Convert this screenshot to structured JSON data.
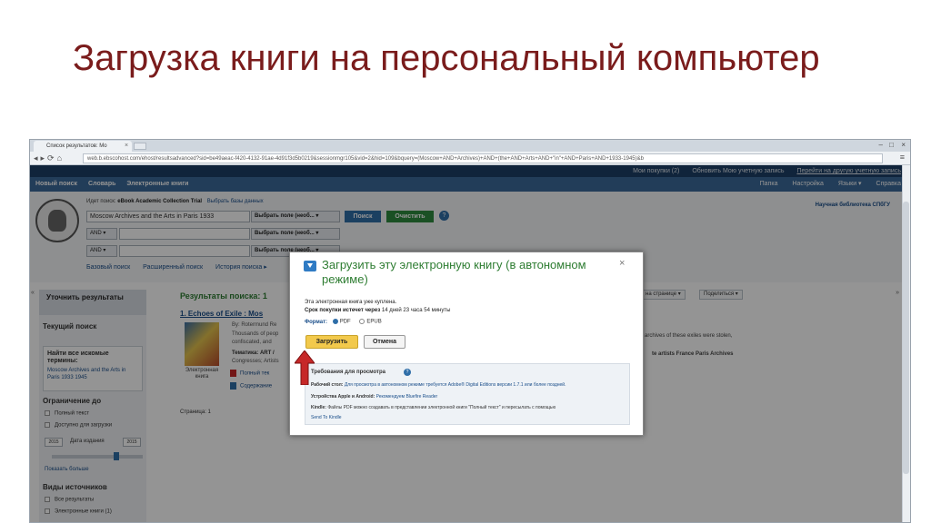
{
  "slide": {
    "title": "Загрузка книги на персональный компьютер"
  },
  "browser": {
    "tab_title": "Список результатов: Mo",
    "url": "web.b.ebscohost.com/ehost/resultsadvanced?sid=be49aeac-f420-4132-91ae-4d91f3d5b0219&sessionmgr105&vid=2&hid=109&bquery=(Moscow+AND+Archives)+AND+(the+AND+Arts+AND+\"in\"+AND+Paris+AND+1933-1945)&b"
  },
  "ebsco": {
    "top_links": [
      "Мои покупки (2)",
      "Обновить Мою учетную запись",
      "Перейти на другую учетную запись"
    ],
    "nav_left": [
      "Новый поиск",
      "Словарь",
      "Электронные книги"
    ],
    "nav_right": [
      "Папка",
      "Настройка",
      "Языки ▾",
      "Справка"
    ],
    "search_hint_prefix": "Идет поиск:",
    "search_hint_db": "eBook Academic Collection Trial",
    "search_hint_link": "Выбрать базы данных",
    "query": "Moscow Archives and the Arts in Paris 1933",
    "field_select": "Выбрать поле (необ...  ▾",
    "search_button": "Поиск",
    "clear_button": "Очистить",
    "and_label": "AND ▾",
    "links": [
      "Базовый поиск",
      "Расширенный поиск",
      "История поиска ▸"
    ],
    "library": "Научная библиотека СПбГУ"
  },
  "sidebar": {
    "refine_title": "Уточнить результаты",
    "current_search": "Текущий поиск",
    "all_terms_title": "Найти все искомые термины:",
    "all_terms_link": "Moscow Archives and the Arts in Paris 1933 1945",
    "limit_title": "Ограничение до",
    "full_text": "Полный текст",
    "downloadable": "Доступно для загрузки",
    "date_from": "2015",
    "date_label": "Дата издания",
    "date_to": "2015",
    "show_more": "Показать больше",
    "source_types": "Виды источников",
    "all_results": "Все результаты",
    "ebooks": "Электронные книги (1)"
  },
  "results": {
    "header": "Результаты поиска: 1",
    "item_title": "1. Echoes of Exile : Mos",
    "item_author": "By: Rotermund Re",
    "item_text_1": "Thousands of peop",
    "item_text_2": "confiscated, and",
    "item_subject": "Тематика: ART /",
    "item_subject_2": "Congresses; Artists",
    "thumb_caption": "Электронная книга",
    "full_text_link": "Полный тек",
    "contents_link": "Содержание",
    "pages": "Страница: 1",
    "right_text_1": "archives of these exiles were stolen,",
    "right_text_2": "te artists  France  Paris  Archives",
    "share_button": "Поделиться ▾",
    "pages_button": "на странице ▾"
  },
  "modal": {
    "title": "Загрузить эту электронную книгу (в автономном режиме)",
    "close": "×",
    "purchased": "Эта электронная книга уже куплена.",
    "expiry_label": "Срок покупки истечет через",
    "expiry_value": "14 дней 23 часа 54 минуты",
    "format_label": "Формат:",
    "format_pdf": "PDF",
    "format_epub": "EPUB",
    "download_button": "Загрузить",
    "cancel_button": "Отмена",
    "req_title": "Требования для просмотра",
    "req_desktop_label": "Рабочий стол:",
    "req_desktop_text": "Для просмотра в автономном режиме требуется Adobe® Digital Editions версии 1.7.1 или более поздней.",
    "req_mobile_label": "Устройства Apple и Android:",
    "req_mobile_text": "Рекомендуем Bluefire Reader",
    "req_kindle_label": "Kindle:",
    "req_kindle_text": "Файлы PDF можно создавать в представлении электронной книги \"Полный текст\" и пересылать с помощью",
    "req_kindle_link": "Send To Kindle"
  },
  "colors": {
    "title": "#7a1c1c",
    "ebsco_dark": "#1d3f66",
    "ebsco_nav": "#3c6a99",
    "green": "#2e7d32",
    "download_button": "#f2c94c",
    "arrow": "#c62828"
  }
}
